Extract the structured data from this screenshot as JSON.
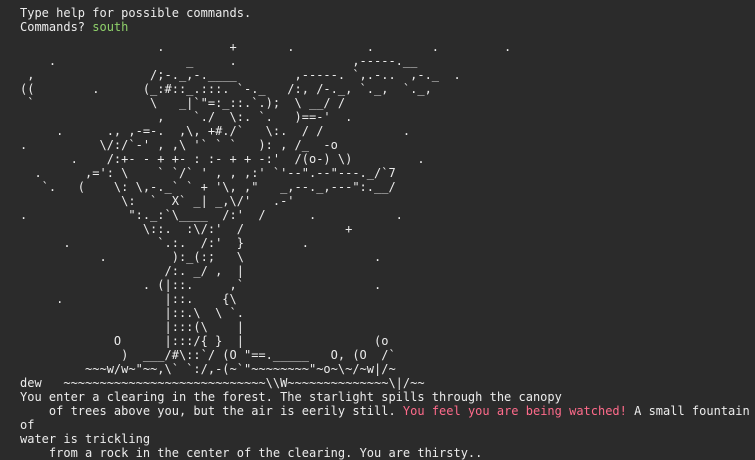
{
  "colors": {
    "background": "#2b2b2b",
    "text": "#ececec",
    "user_input": "#8fd16a",
    "warning": "#ff6b8b"
  },
  "terminal": {
    "intro": "Type help for possible commands.",
    "prompt_label": "Commands? ",
    "user_command": "south",
    "ascii_art": "                   .         +       .          .        .         .\n    .                  _     .                ,-----.__\n ,                /;-._,-.____        ,-----. `,.-..  ,-._  .\n((        .      (_:#::_.:::. `-._   /:, /-._, `._,  `._,\n `                \\   _|`\"=:_::.`.);  \\ __/ /\n                   ,    `./  \\:. `.   )==-'  .\n     .      ., ,-=-.  ,\\, +#./`   \\:.  / /           .\n.          \\/:/`-' , ,\\ '` ` `   ): , /_  -o\n       .    /:+- - + +- : :- + + -:'  /(o-) \\)         .\n  .      ,=': \\    ` `/` ' , , ,:' `'--\".--\"---._/`7\n   `.   (    \\: \\,-._` ` + '\\, ,\"   _,--._,---\":.__/\n              \\:  `  X` _| _,\\/'   .-'\n.              \":._:`\\____  /:'  /      .           .\n                 \\::.  :\\/:'  /              +\n      .            `.:.  /:'  }        .\n           .         ):_(:;   \\                  .\n                    /:. _/ ,  |\n                 . (|::.     ,`                  .\n     .              |::.    {\\\n                    |::.\\  \\ `.\n                    |:::(\\    |\n             O      |:::/{ }  |                  (o\n              )  ___/#\\::`/ (O \"==._____   O, (O  /`\n         ~~~w/w~\"~~,\\` `:/,-(~`\"~~~~~~~~\"~o~\\~/~w|/~",
    "ascii_tail": "dew   ~~~~~~~~~~~~~~~~~~~~~~~~~~~~\\\\W~~~~~~~~~~~~~~\\|/~~",
    "desc_1": "You enter a clearing in the forest. The starlight spills through the canopy",
    "desc_2a": "    of trees above you, but the air is eerily still. ",
    "desc_warning": "You feel you are being watched!",
    "desc_2b": " A small fountain of",
    "desc_3": "water is trickling",
    "desc_4": "    from a rock in the center of the clearing. You are thirsty..",
    "next_prompt": "?"
  }
}
